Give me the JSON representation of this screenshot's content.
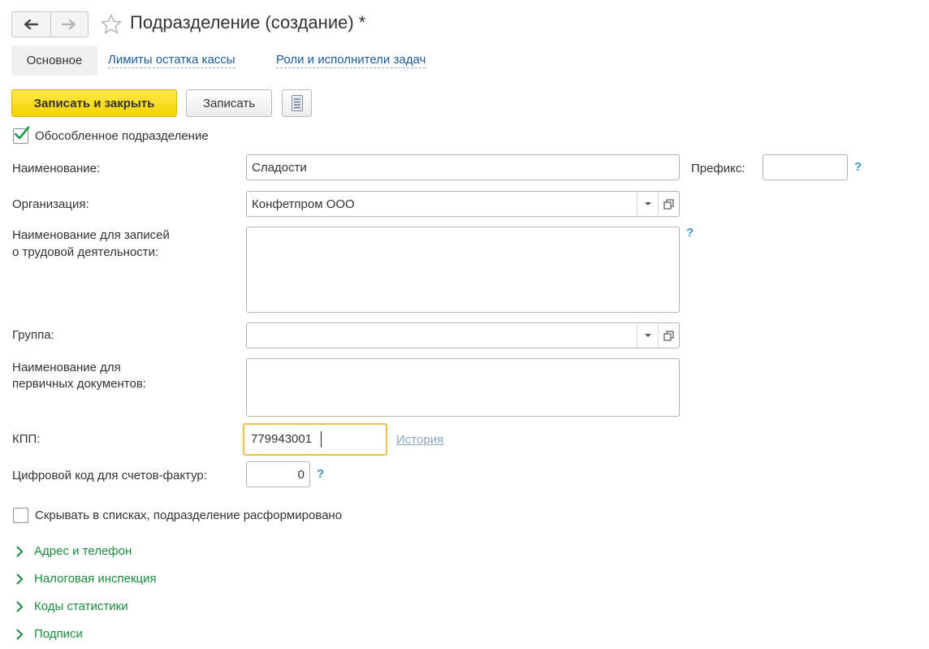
{
  "header": {
    "title": "Подразделение (создание) *"
  },
  "tabs": [
    {
      "label": "Основное"
    },
    {
      "label": "Лимиты остатка кассы"
    },
    {
      "label": "Роли и исполнители задач"
    }
  ],
  "toolbar": {
    "save_close_label": "Записать и закрыть",
    "save_label": "Записать"
  },
  "form": {
    "separate_unit_label": "Обособленное подразделение",
    "separate_unit_checked": true,
    "name_label": "Наименование:",
    "name_value": "Сладости",
    "prefix_label": "Префикс:",
    "prefix_value": "",
    "org_label": "Организация:",
    "org_value": "Конфетпром ООО",
    "labor_name_label_1": "Наименование для записей",
    "labor_name_label_2": "о трудовой деятельности:",
    "labor_name_value": "",
    "group_label": "Группа:",
    "group_value": "",
    "primary_docs_label_1": "Наименование для",
    "primary_docs_label_2": "первичных документов:",
    "primary_docs_value": "",
    "kpp_label": "КПП:",
    "kpp_value": "779943001",
    "history_link": "История",
    "digital_code_label": "Цифровой код для счетов-фактур:",
    "digital_code_value": "0",
    "hide_label": "Скрывать в списках, подразделение расформировано",
    "hide_checked": false,
    "help_symbol": "?"
  },
  "sections": [
    {
      "label": "Адрес и телефон"
    },
    {
      "label": "Налоговая инспекция"
    },
    {
      "label": "Коды статистики"
    },
    {
      "label": "Подписи"
    }
  ],
  "colors": {
    "accent_yellow": "#f5d200",
    "link_blue": "#1a5b9c",
    "section_green": "#1b8a3e",
    "help_blue": "#3f91c6",
    "focus_border": "#e8c34a"
  },
  "icons": {
    "back": "arrow-left-icon",
    "forward": "arrow-right-icon",
    "favorite": "star-outline-icon",
    "more": "list-menu-icon",
    "dropdown": "triangle-down-icon",
    "open": "open-window-icon",
    "section": "chevron-right-icon",
    "check": "checkmark-icon"
  }
}
